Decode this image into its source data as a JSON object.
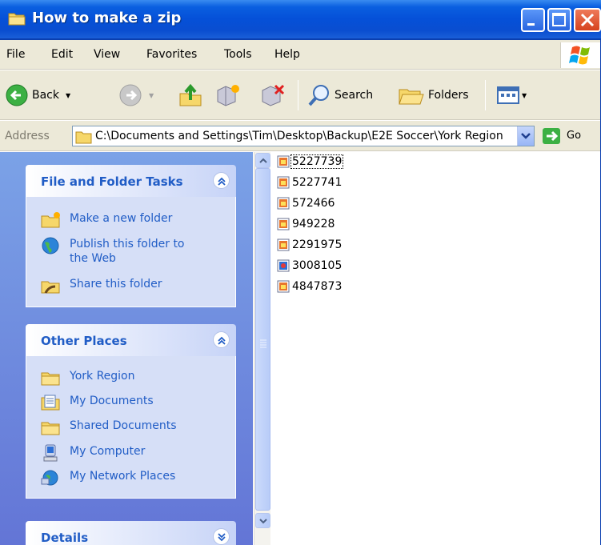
{
  "window": {
    "title": "How to make a zip"
  },
  "menu": [
    "File",
    "Edit",
    "View",
    "Favorites",
    "Tools",
    "Help"
  ],
  "toolbar": {
    "back_label": "Back",
    "search_label": "Search",
    "folders_label": "Folders"
  },
  "address": {
    "label": "Address",
    "value": "C:\\Documents and Settings\\Tim\\Desktop\\Backup\\E2E Soccer\\York Region",
    "go_label": "Go"
  },
  "file_tasks": {
    "title": "File and Folder Tasks",
    "items": [
      {
        "label": "Make a new folder",
        "icon": "new-folder-icon"
      },
      {
        "label": "Publish this folder to the Web",
        "icon": "publish-web-icon"
      },
      {
        "label": "Share this folder",
        "icon": "share-folder-icon"
      }
    ]
  },
  "other_places": {
    "title": "Other Places",
    "items": [
      {
        "label": "York Region",
        "icon": "folder-icon"
      },
      {
        "label": "My Documents",
        "icon": "my-documents-icon"
      },
      {
        "label": "Shared Documents",
        "icon": "folder-icon"
      },
      {
        "label": "My Computer",
        "icon": "my-computer-icon"
      },
      {
        "label": "My Network Places",
        "icon": "network-places-icon"
      }
    ]
  },
  "details": {
    "title": "Details"
  },
  "files": [
    {
      "name": "5227739",
      "icon": "image-file-icon",
      "selected": true
    },
    {
      "name": "5227741",
      "icon": "image-file-icon"
    },
    {
      "name": "572466",
      "icon": "image-file-icon"
    },
    {
      "name": "949228",
      "icon": "image-file-icon"
    },
    {
      "name": "2291975",
      "icon": "image-file-icon"
    },
    {
      "name": "3008105",
      "icon": "bitmap-file-icon"
    },
    {
      "name": "4847873",
      "icon": "image-file-icon"
    }
  ],
  "colors": {
    "titlebar": "#0a5fe0",
    "taskpane_link": "#215dc6",
    "taskpane_bg": "#6f8fe0"
  }
}
